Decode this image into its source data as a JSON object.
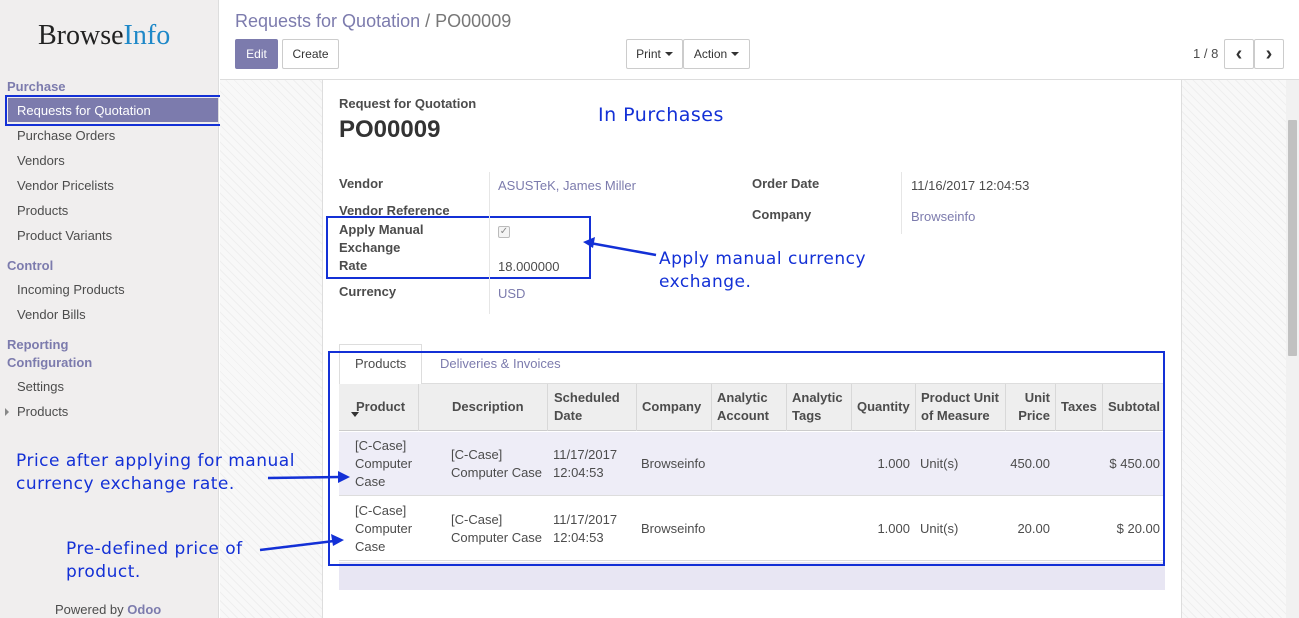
{
  "app": {
    "logo_main": "Browse",
    "logo_accent": "Info",
    "powered_by": "Powered by",
    "powered_brand": "Odoo"
  },
  "sidebar": {
    "section_purchase": "Purchase",
    "items_purchase": [
      "Requests for Quotation",
      "Purchase Orders",
      "Vendors",
      "Vendor Pricelists",
      "Products",
      "Product Variants"
    ],
    "section_control": "Control",
    "items_control": [
      "Incoming Products",
      "Vendor Bills"
    ],
    "section_reporting": "Reporting",
    "section_configuration": "Configuration",
    "items_config": [
      "Settings",
      "Products"
    ]
  },
  "header": {
    "breadcrumb_parent": "Requests for Quotation",
    "breadcrumb_sep": "/",
    "breadcrumb_current": "PO00009",
    "edit_label": "Edit",
    "create_label": "Create",
    "print_label": "Print",
    "action_label": "Action",
    "pager": "1 / 8",
    "prev_icon": "‹",
    "next_icon": "›"
  },
  "form": {
    "doc_type": "Request for Quotation",
    "doc_name": "PO00009",
    "vendor_label": "Vendor",
    "vendor_value": "ASUSTeK, James Miller",
    "vendor_ref_label": "Vendor Reference",
    "apply_manual_label_1": "Apply Manual",
    "apply_manual_label_2": "Exchange",
    "rate_label": "Rate",
    "apply_manual_checked": true,
    "rate_value": "18.000000",
    "currency_label": "Currency",
    "currency_value": "USD",
    "order_date_label": "Order Date",
    "order_date_value": "11/16/2017 12:04:53",
    "company_label": "Company",
    "company_value": "Browseinfo"
  },
  "annotations": {
    "in_purchases": "In Purchases",
    "apply_manual_1": "Apply manual currency",
    "apply_manual_2": "exchange.",
    "price_after_1": "Price after applying for manual",
    "price_after_2": "currency exchange rate.",
    "predefined_1": "Pre-defined price of",
    "predefined_2": "product."
  },
  "tabs": {
    "products": "Products",
    "deliveries": "Deliveries & Invoices"
  },
  "table": {
    "headers": {
      "product": "Product",
      "description": "Description",
      "scheduled_1": "Scheduled",
      "scheduled_2": "Date",
      "company": "Company",
      "analytic_1": "Analytic",
      "analytic_2": "Account",
      "tags_1": "Analytic",
      "tags_2": "Tags",
      "quantity": "Quantity",
      "uom_1": "Product Unit",
      "uom_2": "of Measure",
      "unit_1": "Unit",
      "unit_2": "Price",
      "taxes": "Taxes",
      "subtotal": "Subtotal"
    },
    "rows": [
      {
        "product_1": "[C-Case]",
        "product_2": "Computer",
        "product_3": "Case",
        "desc_1": "[C-Case]",
        "desc_2": "Computer Case",
        "date_1": "11/17/2017",
        "date_2": "12:04:53",
        "company": "Browseinfo",
        "quantity": "1.000",
        "uom": "Unit(s)",
        "unit_price": "450.00",
        "subtotal": "$ 450.00"
      },
      {
        "product_1": "[C-Case]",
        "product_2": "Computer",
        "product_3": "Case",
        "desc_1": "[C-Case]",
        "desc_2": "Computer Case",
        "date_1": "11/17/2017",
        "date_2": "12:04:53",
        "company": "Browseinfo",
        "quantity": "1.000",
        "uom": "Unit(s)",
        "unit_price": "20.00",
        "subtotal": "$ 20.00"
      }
    ]
  },
  "colors": {
    "accent": "#7c7bad",
    "annotation": "#1330d6",
    "row_highlight": "#eeedf7"
  }
}
